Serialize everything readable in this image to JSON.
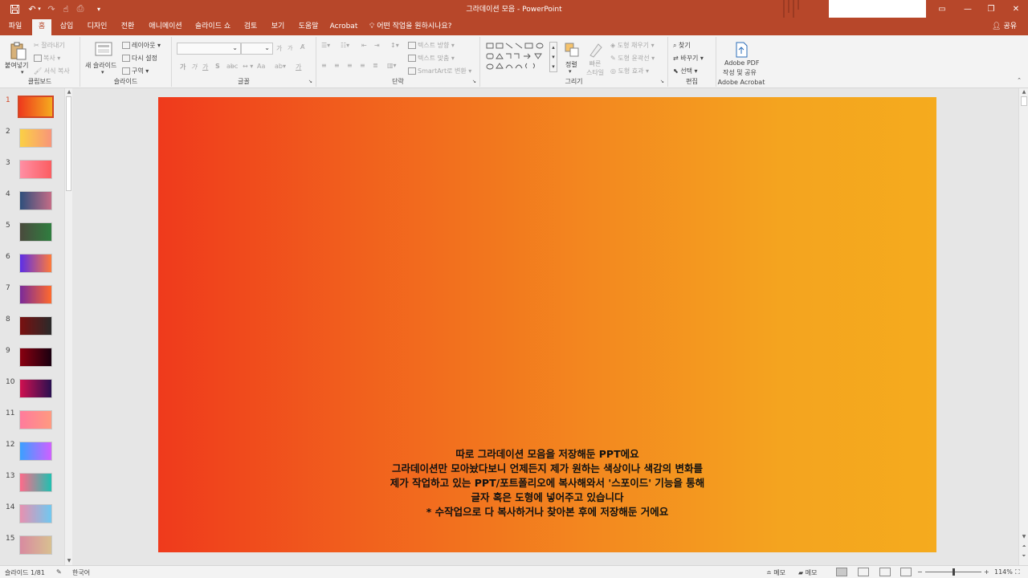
{
  "window": {
    "title": "그라데이션 모음  -  PowerPoint",
    "qat_icons": [
      "save-icon",
      "undo-icon",
      "redo-icon",
      "touch-mode-icon",
      "print-icon",
      "customize-icon"
    ],
    "controls": {
      "minimize": "—",
      "restore": "❐",
      "close": "✕",
      "ribbon_toggle": "▭"
    }
  },
  "tabs": [
    {
      "label": "파일",
      "active": false
    },
    {
      "label": "홈",
      "active": true
    },
    {
      "label": "삽입",
      "active": false
    },
    {
      "label": "디자인",
      "active": false
    },
    {
      "label": "전환",
      "active": false
    },
    {
      "label": "애니메이션",
      "active": false
    },
    {
      "label": "슬라이드 쇼",
      "active": false
    },
    {
      "label": "검토",
      "active": false
    },
    {
      "label": "보기",
      "active": false
    },
    {
      "label": "도움말",
      "active": false
    },
    {
      "label": "Acrobat",
      "active": false
    }
  ],
  "tell_me": "어떤 작업을 원하시나요?",
  "share": "공유",
  "ribbon": {
    "clipboard": {
      "label": "클립보드",
      "paste": "붙여넣기",
      "cut": "잘라내기",
      "copy": "복사",
      "format_painter": "서식 복사"
    },
    "slides": {
      "label": "슬라이드",
      "new_slide": "새 슬라이드",
      "layout": "레이아웃",
      "reset": "다시 설정",
      "section": "구역"
    },
    "font": {
      "label": "글꼴",
      "bold": "가",
      "italic": "가",
      "underline": "가",
      "strike": "S",
      "spacing": "ab",
      "case": "Aa",
      "grow": "가",
      "shrink": "가",
      "color": "가"
    },
    "paragraph": {
      "label": "단락",
      "text_direction": "텍스트 방향",
      "align_text": "텍스트 맞춤",
      "smartart": "SmartArt로 변환"
    },
    "drawing": {
      "label": "그리기",
      "arrange": "정렬",
      "quick_styles": "빠른\n스타일",
      "shape_fill": "도형 채우기",
      "shape_outline": "도형 윤곽선",
      "shape_effects": "도형 효과"
    },
    "editing": {
      "label": "편집",
      "find": "찾기",
      "replace": "바꾸기",
      "select": "선택"
    },
    "adobe": {
      "label": "Adobe Acrobat",
      "create_share_1": "Adobe PDF",
      "create_share_2": "작성 및 공유"
    }
  },
  "thumbnails": [
    {
      "num": "1",
      "selected": true,
      "c1": "#ee3a1d",
      "c2": "#f5ab1e"
    },
    {
      "num": "2",
      "selected": false,
      "c1": "#fbd044",
      "c2": "#f8957a"
    },
    {
      "num": "3",
      "selected": false,
      "c1": "#ff8fa4",
      "c2": "#fb5d61"
    },
    {
      "num": "4",
      "selected": false,
      "c1": "#2e4f7c",
      "c2": "#c46c86"
    },
    {
      "num": "5",
      "selected": false,
      "c1": "#4a4a3d",
      "c2": "#2f7e3f"
    },
    {
      "num": "6",
      "selected": false,
      "c1": "#5b2ee8",
      "c2": "#ff7a3a"
    },
    {
      "num": "7",
      "selected": false,
      "c1": "#7a2a9a",
      "c2": "#ff6a2d"
    },
    {
      "num": "8",
      "selected": false,
      "c1": "#7a1010",
      "c2": "#2a2a2a"
    },
    {
      "num": "9",
      "selected": false,
      "c1": "#8a0010",
      "c2": "#1a0010"
    },
    {
      "num": "10",
      "selected": false,
      "c1": "#d01050",
      "c2": "#2a1050"
    },
    {
      "num": "11",
      "selected": false,
      "c1": "#ff7b9c",
      "c2": "#ff9a80"
    },
    {
      "num": "12",
      "selected": false,
      "c1": "#3aa0ff",
      "c2": "#d060ff"
    },
    {
      "num": "13",
      "selected": false,
      "c1": "#ff6a8a",
      "c2": "#20c0b0"
    },
    {
      "num": "14",
      "selected": false,
      "c1": "#e890b0",
      "c2": "#70c8f0"
    },
    {
      "num": "15",
      "selected": false,
      "c1": "#d88aa0",
      "c2": "#d8c090"
    }
  ],
  "slide": {
    "gradient_start": "#ef3a1c",
    "gradient_end": "#f5ab1e",
    "lines": [
      "따로 그라데이션 모음을 저장해둔 PPT에요",
      "그라데이션만 모아놨다보니 언제든지 제가 원하는 색상이나 색감의 변화를",
      "제가 작업하고 있는 PPT/포트폴리오에 복사해와서 '스포이드' 기능을 통해",
      "글자 혹은 도형에 넣어주고 있습니다",
      "* 수작업으로 다 복사하거나 찾아본 후에 저장해둔 거에요"
    ]
  },
  "statusbar": {
    "slide_info": "슬라이드 1/81",
    "language": "한국어",
    "notes": "메모",
    "comments": "메모",
    "zoom": "114%"
  }
}
